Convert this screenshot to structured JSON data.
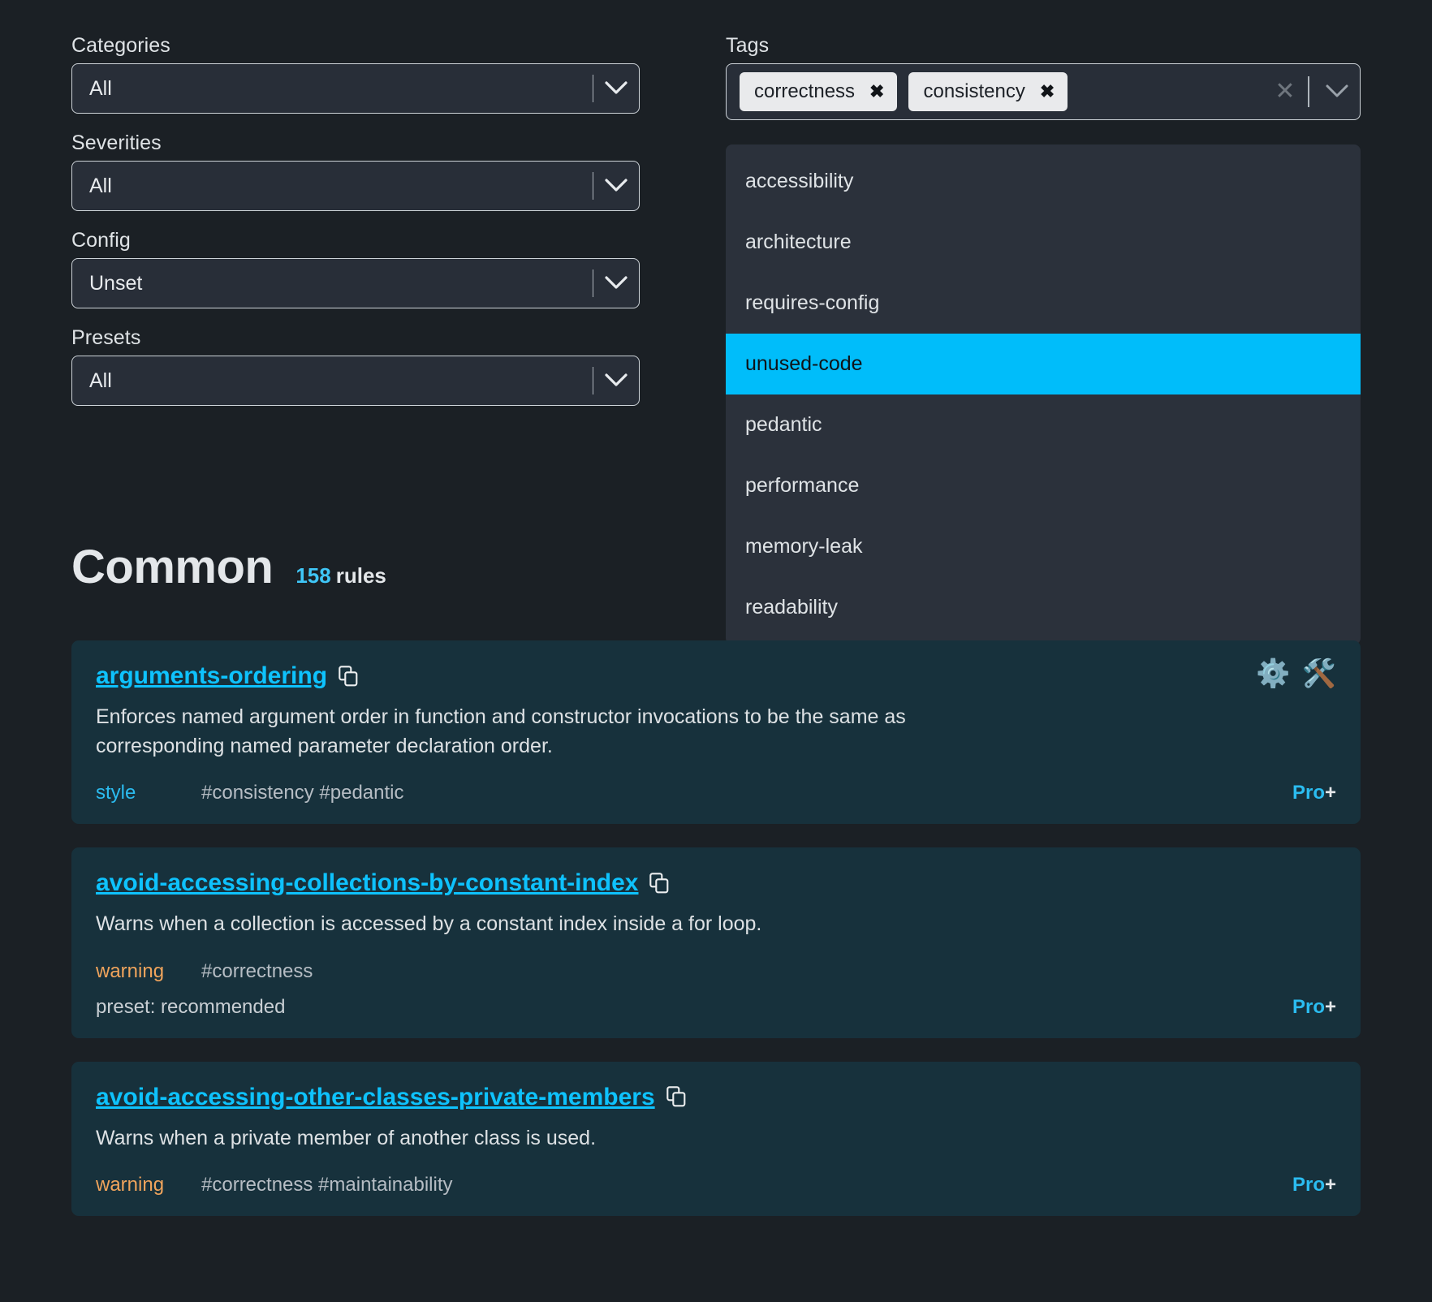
{
  "filters": {
    "categories": {
      "label": "Categories",
      "value": "All"
    },
    "severities": {
      "label": "Severities",
      "value": "All"
    },
    "config": {
      "label": "Config",
      "value": "Unset"
    },
    "presets": {
      "label": "Presets",
      "value": "All"
    },
    "tags": {
      "label": "Tags",
      "selected": [
        "correctness",
        "consistency"
      ],
      "chip_remove_glyph": "✖",
      "clear_glyph": "✕",
      "options": [
        "accessibility",
        "architecture",
        "requires-config",
        "unused-code",
        "pedantic",
        "performance",
        "memory-leak",
        "readability"
      ],
      "highlighted_option": "unused-code"
    }
  },
  "section": {
    "title": "Common",
    "count": "158",
    "count_unit": "rules"
  },
  "rules": [
    {
      "name": "arguments-ordering",
      "description": "Enforces named argument order in function and constructor invocations to be the same as corresponding named parameter declaration order.",
      "severity": "style",
      "severity_kind": "style",
      "tags": "#consistency #pedantic",
      "preset": "",
      "pro_label": "Pro",
      "pro_plus": "+",
      "icons": [
        "gear-emoji",
        "hammer-and-wrench-emoji"
      ],
      "gear_glyph": "⚙️",
      "tools_glyph": "🛠️"
    },
    {
      "name": "avoid-accessing-collections-by-constant-index",
      "description": "Warns when a collection is accessed by a constant index inside a for loop.",
      "severity": "warning",
      "severity_kind": "warning",
      "tags": "#correctness",
      "preset": "preset: recommended",
      "pro_label": "Pro",
      "pro_plus": "+",
      "icons": []
    },
    {
      "name": "avoid-accessing-other-classes-private-members",
      "description": "Warns when a private member of another class is used.",
      "severity": "warning",
      "severity_kind": "warning",
      "tags": "#correctness #maintainability",
      "preset": "",
      "pro_label": "Pro",
      "pro_plus": "+",
      "icons": []
    }
  ],
  "colors": {
    "background": "#1b2025",
    "card_background": "#17313c",
    "accent_cyan": "#0ec2fd",
    "highlight_cyan": "#00bdfa",
    "warning_orange": "#f0a45c",
    "field_background": "#282e38",
    "dropdown_background": "#2b313b"
  }
}
